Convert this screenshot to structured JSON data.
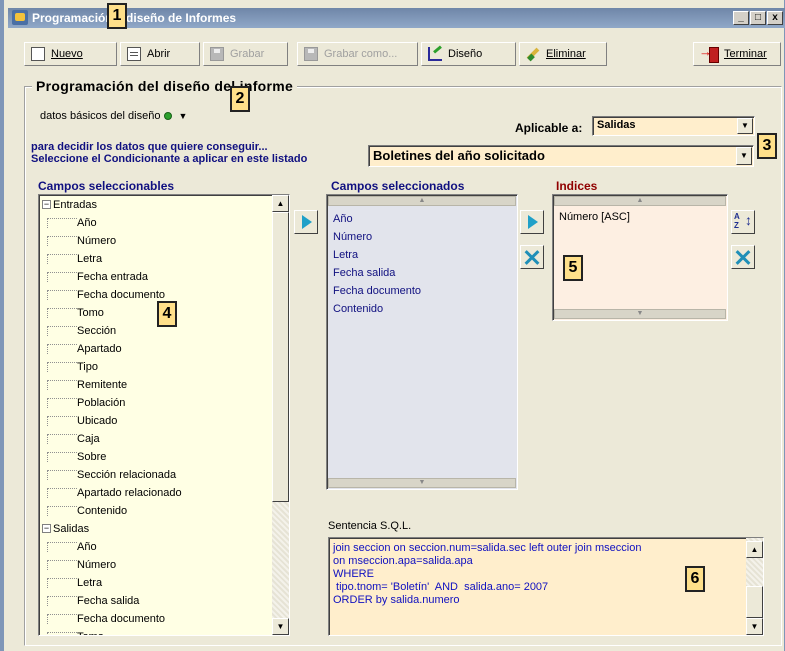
{
  "window": {
    "title": "Programación y diseño de Informes",
    "controls": [
      "_",
      "□",
      "x"
    ]
  },
  "toolbar": {
    "nuevo": "Nuevo",
    "abrir": "Abrir",
    "grabar": "Grabar",
    "grabar_como": "Grabar como...",
    "diseno": "Diseño",
    "eliminar": "Eliminar",
    "terminar": "Terminar"
  },
  "group": {
    "title": "Programación del diseño del informe"
  },
  "basic": {
    "label": "datos básicos del diseño",
    "status_color": "#2ca02c"
  },
  "aplicable": {
    "label": "Aplicable a:",
    "value": "Salidas"
  },
  "condicionante": {
    "line1": "para decidir los datos que quiere conseguir...",
    "line2": "Seleccione el Condicionante a aplicar en este listado",
    "value": "Boletines del año solicitado"
  },
  "headers": {
    "campos_seleccionables": "Campos seleccionables",
    "campos_seleccionados": "Campos seleccionados",
    "indices": "Indices"
  },
  "tree": {
    "groups": [
      {
        "name": "Entradas",
        "expander": "−",
        "items": [
          "Año",
          "Número",
          "Letra",
          "Fecha entrada",
          "Fecha documento",
          "Tomo",
          "Sección",
          "Apartado",
          "Tipo",
          "Remitente",
          "Población",
          "Ubicado",
          "Caja",
          "Sobre",
          "Sección relacionada",
          "Apartado relacionado",
          "Contenido"
        ]
      },
      {
        "name": "Salidas",
        "expander": "−",
        "items": [
          "Año",
          "Número",
          "Letra",
          "Fecha salida",
          "Fecha documento",
          "Tomo"
        ]
      }
    ]
  },
  "selected_fields": [
    "Año",
    "Número",
    "Letra",
    "Fecha salida",
    "Fecha documento",
    "Contenido"
  ],
  "indices": [
    "Número [ASC]"
  ],
  "sort_icon_text": "A\nZ",
  "sql": {
    "label": "Sentencia S.Q.L.",
    "lines": [
      "join seccion on seccion.num=salida.sec left outer join mseccion",
      "on mseccion.apa=salida.apa",
      "WHERE",
      " tipo.tnom= 'Boletín'  AND  salida.ano= 2007",
      "ORDER by salida.numero"
    ]
  },
  "callouts": [
    "1",
    "2",
    "3",
    "4",
    "5",
    "6"
  ]
}
